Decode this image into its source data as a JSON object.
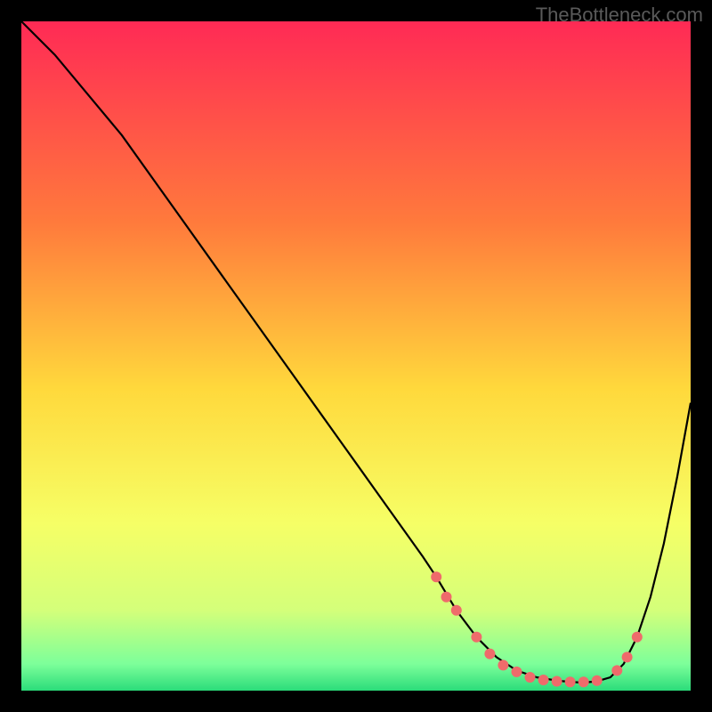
{
  "watermark": "TheBottleneck.com",
  "chart_data": {
    "type": "line",
    "title": "",
    "xlabel": "",
    "ylabel": "",
    "xlim": [
      0,
      100
    ],
    "ylim": [
      0,
      100
    ],
    "gradient_stops": [
      {
        "offset": 0,
        "color": "#ff2a55"
      },
      {
        "offset": 30,
        "color": "#ff7a3c"
      },
      {
        "offset": 55,
        "color": "#ffd93c"
      },
      {
        "offset": 75,
        "color": "#f6ff66"
      },
      {
        "offset": 88,
        "color": "#d4ff7a"
      },
      {
        "offset": 96,
        "color": "#7dff9a"
      },
      {
        "offset": 100,
        "color": "#2bdc7a"
      }
    ],
    "series": [
      {
        "name": "bottleneck-curve",
        "color": "#000000",
        "x": [
          0,
          5,
          10,
          15,
          20,
          25,
          30,
          35,
          40,
          45,
          50,
          55,
          60,
          62,
          65,
          68,
          71,
          74,
          77,
          80,
          82,
          84,
          86,
          88,
          90,
          92,
          94,
          96,
          98,
          100
        ],
        "y": [
          100,
          95,
          89,
          83,
          76,
          69,
          62,
          55,
          48,
          41,
          34,
          27,
          20,
          17,
          12,
          8,
          5,
          3,
          2,
          1.5,
          1.3,
          1.2,
          1.4,
          2,
          4,
          8,
          14,
          22,
          32,
          43
        ]
      }
    ],
    "markers": {
      "name": "valley-markers",
      "color": "#ef6b6b",
      "radius": 6,
      "points": [
        {
          "x": 62,
          "y": 17
        },
        {
          "x": 63.5,
          "y": 14
        },
        {
          "x": 65,
          "y": 12
        },
        {
          "x": 68,
          "y": 8
        },
        {
          "x": 70,
          "y": 5.5
        },
        {
          "x": 72,
          "y": 3.8
        },
        {
          "x": 74,
          "y": 2.8
        },
        {
          "x": 76,
          "y": 2.0
        },
        {
          "x": 78,
          "y": 1.6
        },
        {
          "x": 80,
          "y": 1.4
        },
        {
          "x": 82,
          "y": 1.3
        },
        {
          "x": 84,
          "y": 1.3
        },
        {
          "x": 86,
          "y": 1.5
        },
        {
          "x": 89,
          "y": 3.0
        },
        {
          "x": 90.5,
          "y": 5.0
        },
        {
          "x": 92,
          "y": 8.0
        }
      ]
    }
  }
}
